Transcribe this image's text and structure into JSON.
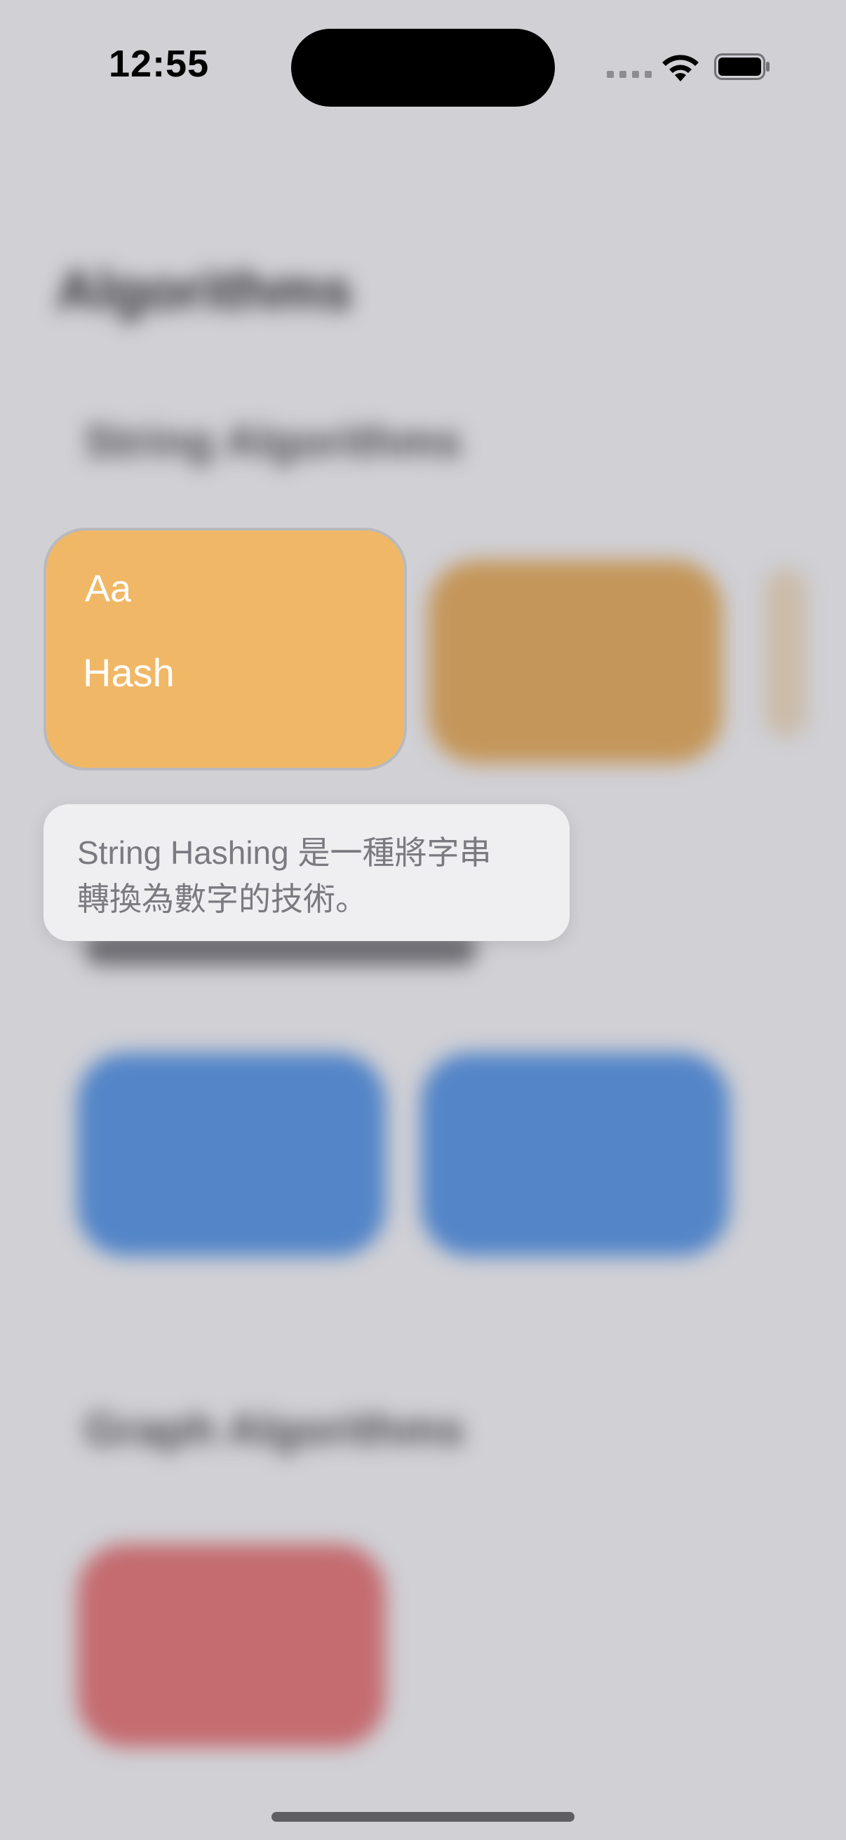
{
  "status_bar": {
    "time": "12:55"
  },
  "focused_card": {
    "icon_text": "Aa",
    "name": "Hash",
    "color": "#f0b866"
  },
  "popover": {
    "text_line1": "String Hashing 是一種將字串",
    "text_line2": "轉換為數字的技術。"
  },
  "colors": {
    "background": "#d0d0d5",
    "orange_card": "#c4965a",
    "blue_card": "#5385c8",
    "red_card": "#c46c70"
  }
}
